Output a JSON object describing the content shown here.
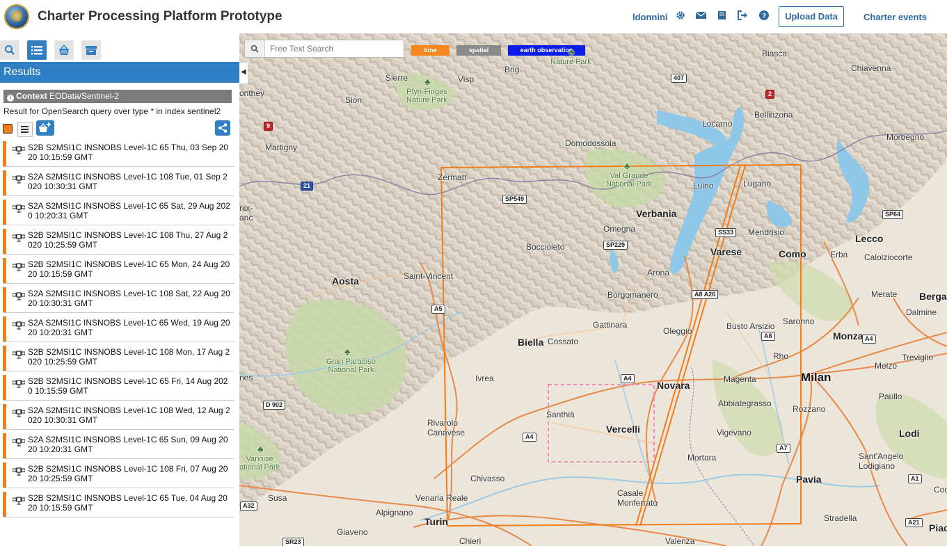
{
  "app": {
    "title": "Charter Processing Platform Prototype",
    "logo": "charter-logo"
  },
  "nav": {
    "user": "ldonnini",
    "icons": [
      "gear-icon",
      "envelope-icon",
      "book-icon",
      "sign-out-icon",
      "help-icon"
    ],
    "upload_label": "Upload Data",
    "charter_events_label": "Charter events"
  },
  "sidebar": {
    "tabs": [
      "search-icon",
      "list-icon",
      "basket-icon",
      "archive-icon"
    ],
    "active_tab": "list-icon",
    "results_title": "Results",
    "context_label": "Context",
    "context_value": "EOData/Sentinel-2",
    "result_info": "Result for OpenSearch query over type * in index sentinel2",
    "accent_color": "#f07d1a",
    "items": [
      {
        "label": "S2B S2MSI1C INSNOBS Level-1C 65 Thu, 03 Sep 2020 10:15:59 GMT"
      },
      {
        "label": "S2A S2MSI1C INSNOBS Level-1C 108 Tue, 01 Sep 2020 10:30:31 GMT"
      },
      {
        "label": "S2A S2MSI1C INSNOBS Level-1C 65 Sat, 29 Aug 2020 10:20:31 GMT"
      },
      {
        "label": "S2B S2MSI1C INSNOBS Level-1C 108 Thu, 27 Aug 2020 10:25:59 GMT"
      },
      {
        "label": "S2B S2MSI1C INSNOBS Level-1C 65 Mon, 24 Aug 2020 10:15:59 GMT"
      },
      {
        "label": "S2A S2MSI1C INSNOBS Level-1C 108 Sat, 22 Aug 2020 10:30:31 GMT"
      },
      {
        "label": "S2A S2MSI1C INSNOBS Level-1C 65 Wed, 19 Aug 2020 10:20:31 GMT"
      },
      {
        "label": "S2B S2MSI1C INSNOBS Level-1C 108 Mon, 17 Aug 2020 10:25:59 GMT"
      },
      {
        "label": "S2B S2MSI1C INSNOBS Level-1C 65 Fri, 14 Aug 2020 10:15:59 GMT"
      },
      {
        "label": "S2A S2MSI1C INSNOBS Level-1C 108 Wed, 12 Aug 2020 10:30:31 GMT"
      },
      {
        "label": "S2A S2MSI1C INSNOBS Level-1C 65 Sun, 09 Aug 2020 10:20:31 GMT"
      },
      {
        "label": "S2B S2MSI1C INSNOBS Level-1C 108 Fri, 07 Aug 2020 10:25:59 GMT"
      },
      {
        "label": "S2B S2MSI1C INSNOBS Level-1C 65 Tue, 04 Aug 2020 10:15:59 GMT"
      }
    ]
  },
  "map": {
    "search_placeholder": "Free Text Search",
    "filters": [
      {
        "label": "time",
        "color": "#f5871f"
      },
      {
        "label": "spatial",
        "color": "#8a8a8a"
      },
      {
        "label": "earth observation",
        "color": "#0a1de8"
      }
    ],
    "footprint_color": "#f07d1a",
    "aoi_color": "#f08fb0",
    "places": {
      "sierre": "Sierre",
      "visp": "Visp",
      "brig": "Brig",
      "sion": "Sion",
      "monthey": "onthey",
      "martigny": "Martigny",
      "domodossola": "Domodossola",
      "locarno": "Locarno",
      "bellinzona": "Bellinzona",
      "biasca": "Biasca",
      "chiavenna": "Chiavenna",
      "morbegno": "Morbegno",
      "zermatt": "Zermatt",
      "luino": "Luino",
      "lugano": "Lugano",
      "verbania": "Verbania",
      "mendrisio": "Mendrisio",
      "lecco": "Lecco",
      "omegna": "Omegna",
      "boccioleto": "Boccioleto",
      "varese": "Varese",
      "como": "Como",
      "erba": "Erba",
      "calolziocorte": "Calolziocorte",
      "aosta": "Aosta",
      "saint_vincent": "Saint-Vincent",
      "arona": "Arona",
      "borgomanero": "Borgomanero",
      "merate": "Merate",
      "bergamo": "Bergan",
      "gattinara": "Gattinara",
      "oleggio": "Oleggio",
      "busto_arsizio": "Busto Arsizio",
      "saronno": "Saronno",
      "dalmine": "Dalmine",
      "biella": "Biella",
      "cossato": "Cossato",
      "monza": "Monza",
      "rho": "Rho",
      "treviglio": "Treviglio",
      "ivrea": "Ivrea",
      "novara": "Novara",
      "magenta": "Magenta",
      "milan": "Milan",
      "melzo": "Melzo",
      "abbiategrasso": "Abbiategrasso",
      "paullo": "Paullo",
      "santhia": "Santhià",
      "rozzano": "Rozzano",
      "rivarolo": "Rivarolo\nCanavese",
      "vercelli": "Vercelli",
      "vigevano": "Vigevano",
      "lodi": "Lodi",
      "mortara": "Mortara",
      "sant_angelo": "Sant'Angelo\nLodigiano",
      "chivasso": "Chivasso",
      "pavia": "Pavia",
      "casale": "Casale\nMonferrato",
      "susa": "Susa",
      "venaria": "Venaria Reale",
      "alpignano": "Alpignano",
      "turin": "Turin",
      "giaveno": "Giaveno",
      "stradella": "Stradella",
      "chieri": "Chieri",
      "valenza": "Valenza",
      "codo": "Codo",
      "piace": "Piace",
      "aix": "nix-\nanc",
      "nes": "nes"
    },
    "parks": {
      "nature_park": "Nature Park",
      "pfyn": "Pfyn-Finges\nNature Park",
      "val_grande": "Val Grande\nNational Park",
      "gran_paradiso": "Gran Paradiso\nNational Park",
      "vanoise": "Vanoise\national Park"
    },
    "roads": {
      "r407": "407",
      "r2": "2",
      "r9": "9",
      "r21": "21",
      "sp549": "SP549",
      "ss33": "SS33",
      "sp64": "SP64",
      "sp229": "SP229",
      "a8a26": "A8 A26",
      "a8": "A8",
      "a4a": "A4",
      "a4b": "A4",
      "a4c": "A4",
      "a5": "A5",
      "d902": "D 902",
      "a7": "A7",
      "a1": "A1",
      "a32": "A32",
      "sr23": "SR23",
      "a21": "A21"
    }
  }
}
